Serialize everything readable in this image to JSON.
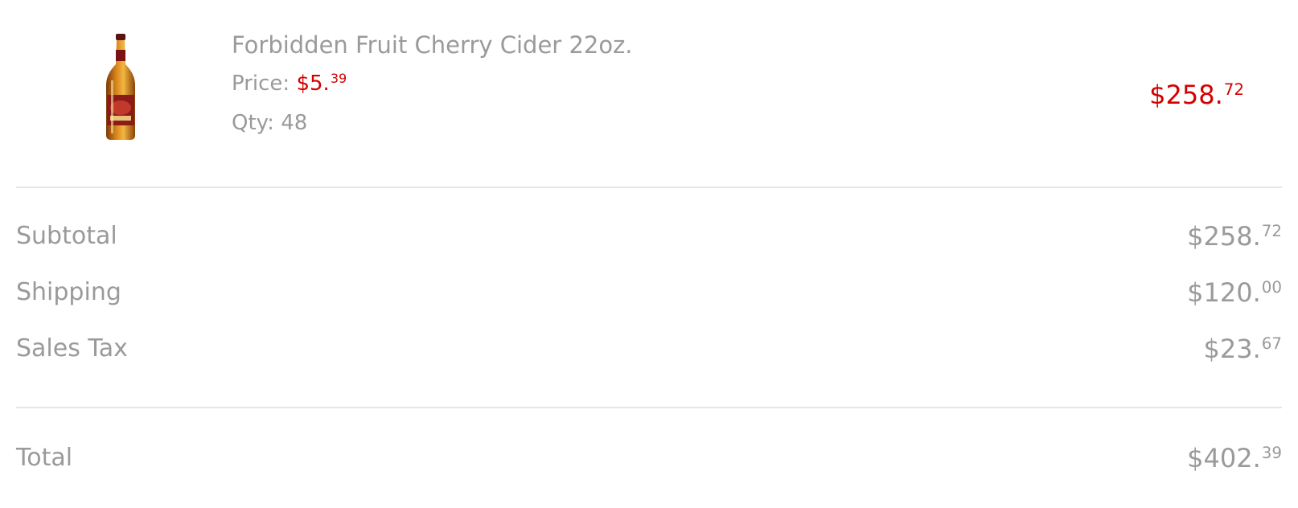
{
  "item": {
    "image_icon": "beer-bottle-icon",
    "name": "Forbidden Fruit Cherry Cider 22oz.",
    "price_label": "Price:",
    "price_dollars": "$5.",
    "price_cents": "39",
    "qty_label": "Qty:",
    "qty_value": "48",
    "line_total_dollars": "$258.",
    "line_total_cents": "72"
  },
  "summary": {
    "subtotal_label": "Subtotal",
    "subtotal_dollars": "$258.",
    "subtotal_cents": "72",
    "shipping_label": "Shipping",
    "shipping_dollars": "$120.",
    "shipping_cents": "00",
    "tax_label": "Sales Tax",
    "tax_dollars": "$23.",
    "tax_cents": "67",
    "total_label": "Total",
    "total_dollars": "$402.",
    "total_cents": "39"
  },
  "colors": {
    "text_gray": "#9a9a9a",
    "price_red": "#d40000",
    "divider": "#e6e6e6"
  }
}
